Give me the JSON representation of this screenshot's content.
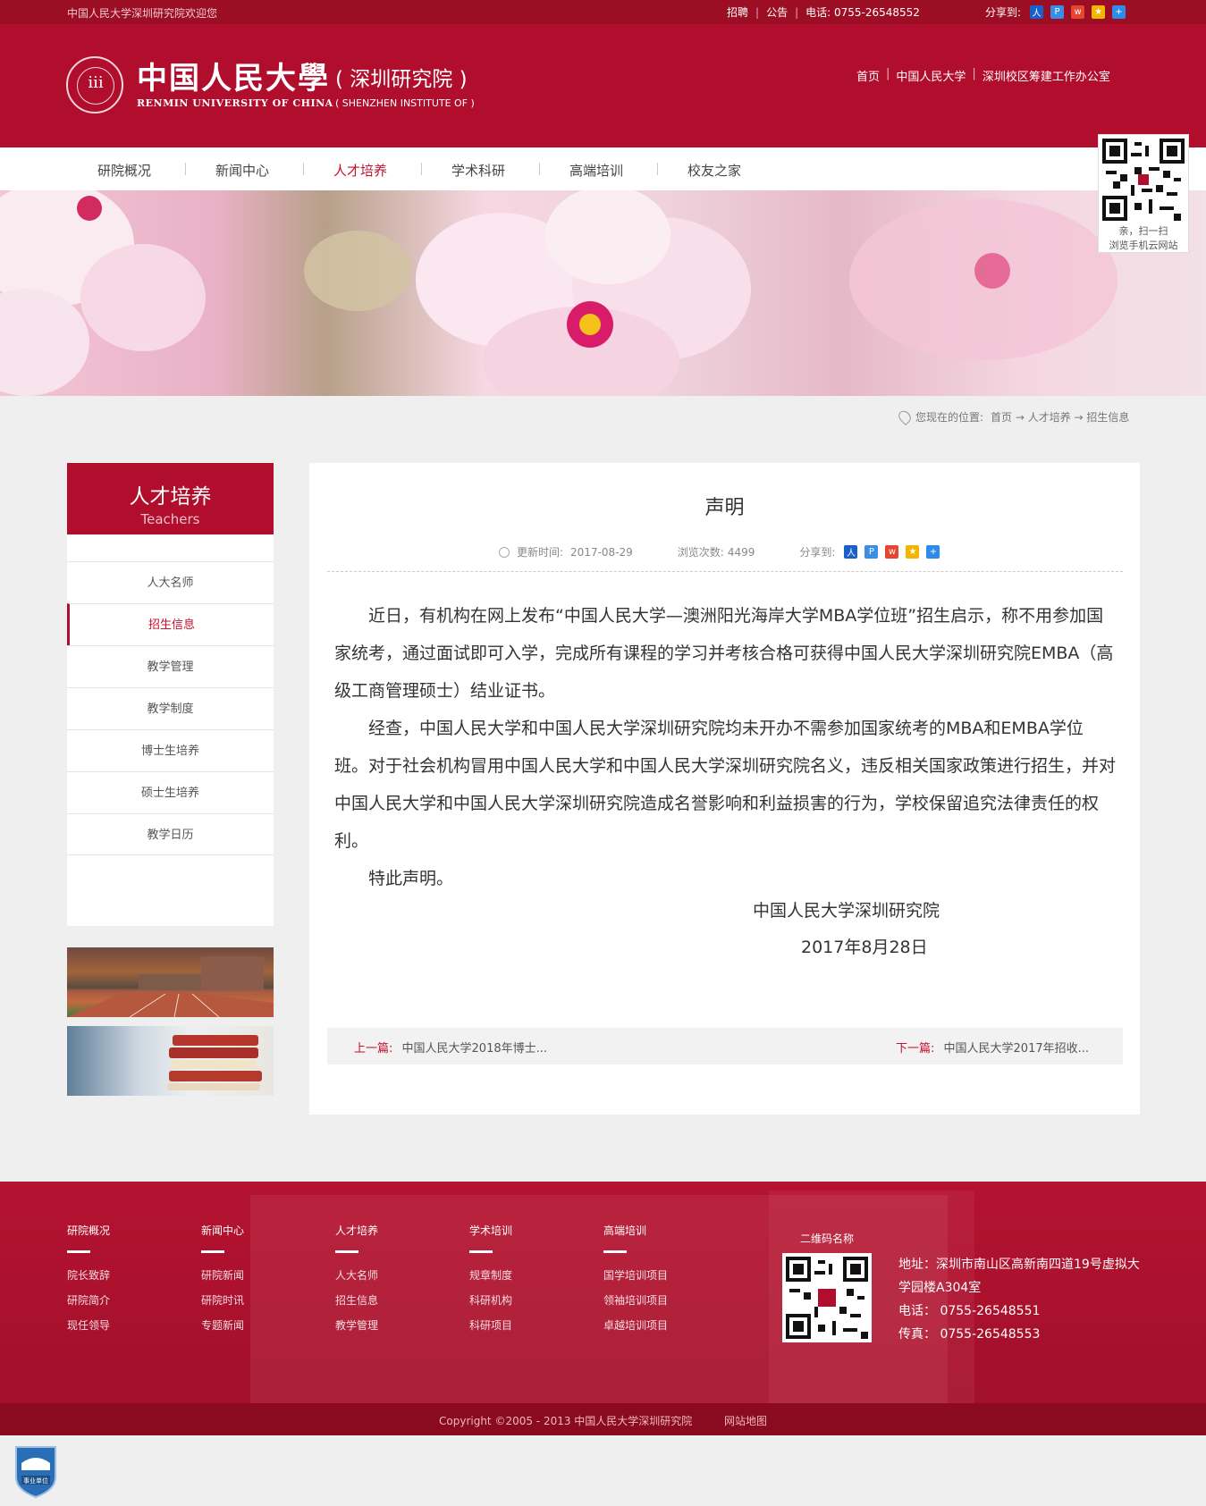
{
  "topbar": {
    "welcome": "中国人民大学深圳研究院欢迎您",
    "links": [
      "招聘",
      "公告"
    ],
    "phone": "电话:   0755-26548552",
    "share_label": "分享到:"
  },
  "header": {
    "title_cn": "中国人民大學",
    "sub_cn": "( 深圳研究院 )",
    "title_en": "RENMIN UNIVERSITY OF CHINA",
    "sub_en": "( SHENZHEN INSTITUTE OF )",
    "links": [
      "首页",
      "中国人民大学",
      "深圳校区筹建工作办公室"
    ]
  },
  "nav": {
    "items": [
      "研院概况",
      "新闻中心",
      "人才培养",
      "学术科研",
      "高端培训",
      "校友之家"
    ],
    "active": "人才培养"
  },
  "qr_top": {
    "line1": "亲，扫一扫",
    "line2": "浏览手机云网站"
  },
  "breadcrumb": {
    "label": "您现在的位置:",
    "path": "首页 → 人才培养 → 招生信息"
  },
  "sidebar": {
    "title": "人才培养",
    "subtitle": "Teachers",
    "items": [
      "人大名师",
      "招生信息",
      "教学管理",
      "教学制度",
      "博士生培养",
      "硕士生培养",
      "教学日历"
    ],
    "active": "招生信息"
  },
  "article": {
    "title": "声明",
    "update_label": "更新时间:",
    "update_date": "2017-08-29",
    "views_label": "浏览次数:",
    "views": "4499",
    "share_label": "分享到:",
    "paragraphs": [
      "近日，有机构在网上发布“中国人民大学—澳洲阳光海岸大学MBA学位班”招生启示，称不用参加国家统考，通过面试即可入学，完成所有课程的学习并考核合格可获得中国人民大学深圳研究院EMBA（高级工商管理硕士）结业证书。",
      "经查，中国人民大学和中国人民大学深圳研究院均未开办不需参加国家统考的MBA和EMBA学位班。对于社会机构冒用中国人民大学和中国人民大学深圳研究院名义，违反相关国家政策进行招生，并对中国人民大学和中国人民大学深圳研究院造成名誉影响和利益损害的行为，学校保留追究法律责任的权利。",
      "特此声明。"
    ],
    "signature": "中国人民大学深圳研究院",
    "date": "2017年8月28日",
    "prev_label": "上一篇:",
    "prev_title": "中国人民大学2018年博士...",
    "next_label": "下一篇:",
    "next_title": "中国人民大学2017年招收..."
  },
  "footer": {
    "columns": [
      {
        "title": "研院概况",
        "items": [
          "院长致辞",
          "研院简介",
          "现任领导"
        ]
      },
      {
        "title": "新闻中心",
        "items": [
          "研院新闻",
          "研院时讯",
          "专题新闻"
        ]
      },
      {
        "title": "人才培养",
        "items": [
          "人大名师",
          "招生信息",
          "教学管理"
        ]
      },
      {
        "title": "学术培训",
        "items": [
          "规章制度",
          "科研机构",
          "科研项目"
        ]
      },
      {
        "title": "高端培训",
        "items": [
          "国学培训项目",
          "领袖培训项目",
          "卓越培训项目"
        ]
      }
    ],
    "qr_title": "二维码名称",
    "address": "地址：深圳市南山区高新南四道19号虚拟大学园楼A304室",
    "phone": "电话：  0755-26548551",
    "fax": "传真：  0755-26548553",
    "copyright": "Copyright ©2005 - 2013 中国人民大学深圳研究院",
    "sitemap": "网站地图",
    "badge_text": "事业单位"
  },
  "colors": {
    "brand_red": "#b10d2d",
    "topbar_red": "#9c0e24",
    "accent_text": "#c4112f"
  }
}
